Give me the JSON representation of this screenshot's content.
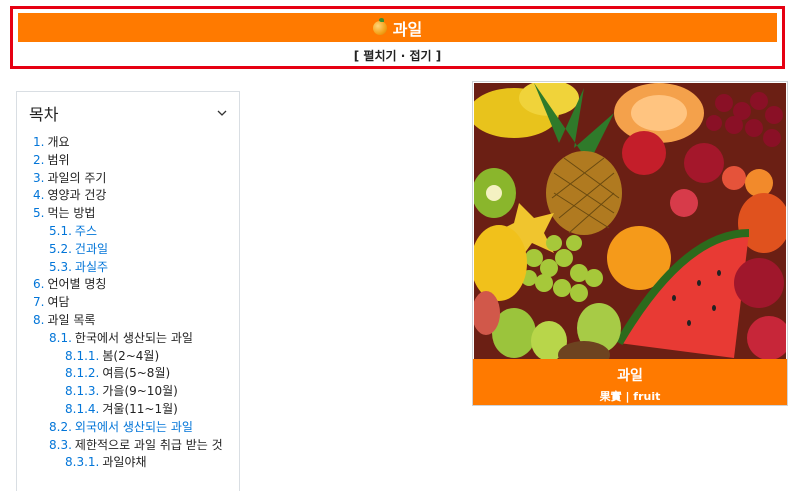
{
  "infobox": {
    "title": "과일",
    "toggle": "[ 펼치기 · 접기 ]",
    "title_icon": "orange-fruit-icon",
    "accent_color": "#ff7a00",
    "border_color": "#e60012"
  },
  "toc": {
    "heading": "목차",
    "collapse_icon": "chevron-down-icon",
    "items": [
      {
        "num": "1.",
        "label": "개요",
        "level": 1,
        "blue": false
      },
      {
        "num": "2.",
        "label": "범위",
        "level": 1,
        "blue": false
      },
      {
        "num": "3.",
        "label": "과일의 주기",
        "level": 1,
        "blue": false
      },
      {
        "num": "4.",
        "label": "영양과 건강",
        "level": 1,
        "blue": false
      },
      {
        "num": "5.",
        "label": "먹는 방법",
        "level": 1,
        "blue": false
      },
      {
        "num": "5.1.",
        "label": "주스",
        "level": 2,
        "blue": true
      },
      {
        "num": "5.2.",
        "label": "건과일",
        "level": 2,
        "blue": true
      },
      {
        "num": "5.3.",
        "label": "과실주",
        "level": 2,
        "blue": true
      },
      {
        "num": "6.",
        "label": "언어별 명칭",
        "level": 1,
        "blue": false
      },
      {
        "num": "7.",
        "label": "여담",
        "level": 1,
        "blue": false
      },
      {
        "num": "8.",
        "label": "과일 목록",
        "level": 1,
        "blue": false
      },
      {
        "num": "8.1.",
        "label": "한국에서 생산되는 과일",
        "level": 2,
        "blue": false
      },
      {
        "num": "8.1.1.",
        "label": "봄(2~4월)",
        "level": 3,
        "blue": false
      },
      {
        "num": "8.1.2.",
        "label": "여름(5~8월)",
        "level": 3,
        "blue": false
      },
      {
        "num": "8.1.3.",
        "label": "가을(9~10월)",
        "level": 3,
        "blue": false
      },
      {
        "num": "8.1.4.",
        "label": "겨울(11~1월)",
        "level": 3,
        "blue": false
      },
      {
        "num": "8.2.",
        "label": "외국에서 생산되는 과일",
        "level": 2,
        "blue": true
      },
      {
        "num": "8.3.",
        "label": "제한적으로 과일 취급 받는 것",
        "level": 2,
        "blue": false
      },
      {
        "num": "8.3.1.",
        "label": "과일야채",
        "level": 3,
        "blue": false
      }
    ]
  },
  "card": {
    "caption_title": "과일",
    "caption_sub": "果實 | fruit",
    "image_alt": "assorted fruits"
  }
}
